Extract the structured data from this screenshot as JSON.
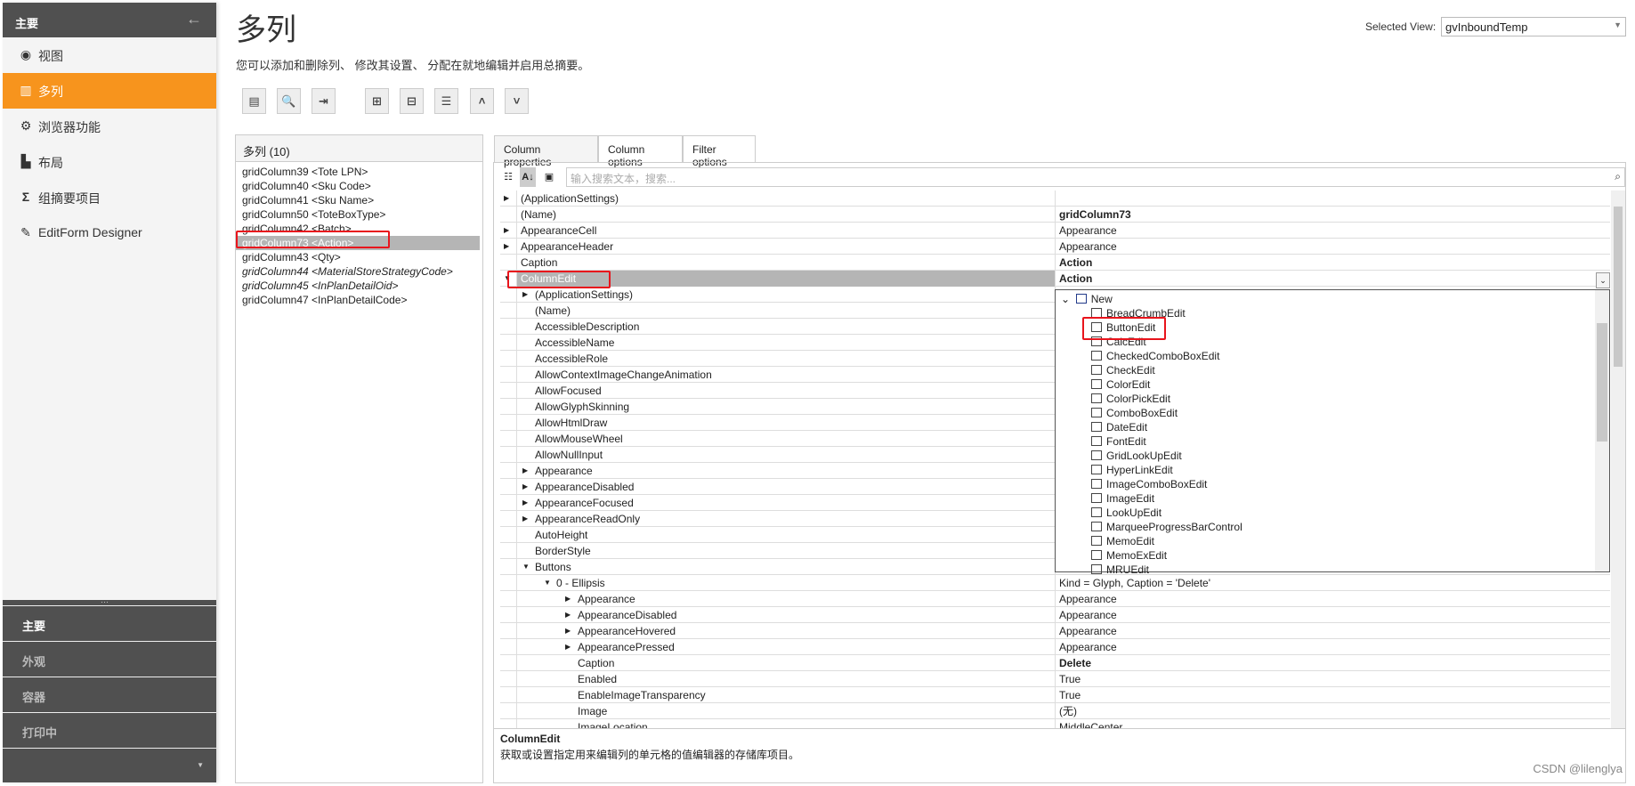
{
  "sidebar": {
    "header": "主要",
    "items": [
      {
        "icon": "eye-icon",
        "glyph": "◉",
        "label": "视图"
      },
      {
        "icon": "columns-icon",
        "glyph": "▥",
        "label": "多列",
        "active": true
      },
      {
        "icon": "gear-icon",
        "glyph": "⚙",
        "label": "浏览器功能"
      },
      {
        "icon": "layout-icon",
        "glyph": "▙",
        "label": "布局"
      },
      {
        "icon": "sigma-icon",
        "glyph": "Σ",
        "label": "组摘要项目"
      },
      {
        "icon": "edit-form-icon",
        "glyph": "✎",
        "label": "EditForm Designer"
      }
    ],
    "bottom": [
      "主要",
      "外观",
      "容器",
      "打印中"
    ]
  },
  "page": {
    "title": "多列",
    "subtitle": "您可以添加和删除列、 修改其设置、 分配在就地编辑并启用总摘要。"
  },
  "toolbar": [
    {
      "icon": "list-icon",
      "glyph": "▤"
    },
    {
      "icon": "search-icon",
      "glyph": "🔍"
    },
    {
      "icon": "export-icon",
      "glyph": "⇥"
    },
    {
      "icon": "insert-column-icon",
      "glyph": "⊞"
    },
    {
      "icon": "add-column-icon",
      "glyph": "⊟"
    },
    {
      "icon": "remove-column-icon",
      "glyph": "☰"
    },
    {
      "icon": "move-up-icon",
      "glyph": "˄"
    },
    {
      "icon": "move-down-icon",
      "glyph": "˅"
    }
  ],
  "selected_view": {
    "label": "Selected View:",
    "value": "gvInboundTemp"
  },
  "columns_panel": {
    "header": "多列 (10)",
    "items": [
      {
        "t": "gridColumn39 <Tote LPN>"
      },
      {
        "t": "gridColumn40 <Sku Code>"
      },
      {
        "t": "gridColumn41 <Sku Name>"
      },
      {
        "t": "gridColumn50 <ToteBoxType>"
      },
      {
        "t": "gridColumn42 <Batch>"
      },
      {
        "t": "gridColumn73 <Action>",
        "sel": true
      },
      {
        "t": "gridColumn43 <Qty>"
      },
      {
        "t": "gridColumn44 <MaterialStoreStrategyCode>",
        "it": true
      },
      {
        "t": "gridColumn45 <InPlanDetailOid>",
        "it": true
      },
      {
        "t": "gridColumn47 <InPlanDetailCode>"
      }
    ]
  },
  "tabs": [
    "Column properties",
    "Column options",
    "Filter options"
  ],
  "search_placeholder": "输入搜索文本，搜索...",
  "properties": [
    {
      "n": "(ApplicationSettings)",
      "v": "",
      "l": 0,
      "e": "r"
    },
    {
      "n": "(Name)",
      "v": "gridColumn73",
      "l": 0,
      "b": true
    },
    {
      "n": "AppearanceCell",
      "v": "Appearance",
      "l": 0,
      "e": "r"
    },
    {
      "n": "AppearanceHeader",
      "v": "Appearance",
      "l": 0,
      "e": "r"
    },
    {
      "n": "Caption",
      "v": "Action",
      "l": 0,
      "b": true
    },
    {
      "n": "ColumnEdit",
      "v": "Action",
      "l": 0,
      "e": "d",
      "b": true,
      "sel": true
    },
    {
      "n": "(ApplicationSettings)",
      "v": "",
      "l": 1,
      "e": "r"
    },
    {
      "n": "(Name)",
      "v": "",
      "l": 1
    },
    {
      "n": "AccessibleDescription",
      "v": "",
      "l": 1
    },
    {
      "n": "AccessibleName",
      "v": "",
      "l": 1
    },
    {
      "n": "AccessibleRole",
      "v": "",
      "l": 1
    },
    {
      "n": "AllowContextImageChangeAnimation",
      "v": "",
      "l": 1
    },
    {
      "n": "AllowFocused",
      "v": "",
      "l": 1
    },
    {
      "n": "AllowGlyphSkinning",
      "v": "",
      "l": 1
    },
    {
      "n": "AllowHtmlDraw",
      "v": "",
      "l": 1
    },
    {
      "n": "AllowMouseWheel",
      "v": "",
      "l": 1
    },
    {
      "n": "AllowNullInput",
      "v": "",
      "l": 1
    },
    {
      "n": "Appearance",
      "v": "",
      "l": 1,
      "e": "r"
    },
    {
      "n": "AppearanceDisabled",
      "v": "",
      "l": 1,
      "e": "r"
    },
    {
      "n": "AppearanceFocused",
      "v": "",
      "l": 1,
      "e": "r"
    },
    {
      "n": "AppearanceReadOnly",
      "v": "",
      "l": 1,
      "e": "r"
    },
    {
      "n": "AutoHeight",
      "v": "",
      "l": 1
    },
    {
      "n": "BorderStyle",
      "v": "",
      "l": 1
    },
    {
      "n": "Buttons",
      "v": "",
      "l": 1,
      "e": "d"
    },
    {
      "n": "0 - Ellipsis",
      "v": "Kind = Glyph, Caption = 'Delete'",
      "l": 2,
      "e": "d"
    },
    {
      "n": "Appearance",
      "v": "Appearance",
      "l": 3,
      "e": "r"
    },
    {
      "n": "AppearanceDisabled",
      "v": "Appearance",
      "l": 3,
      "e": "r"
    },
    {
      "n": "AppearanceHovered",
      "v": "Appearance",
      "l": 3,
      "e": "r"
    },
    {
      "n": "AppearancePressed",
      "v": "Appearance",
      "l": 3,
      "e": "r"
    },
    {
      "n": "Caption",
      "v": "Delete",
      "l": 3,
      "b": true
    },
    {
      "n": "Enabled",
      "v": "True",
      "l": 3
    },
    {
      "n": "EnableImageTransparency",
      "v": "True",
      "l": 3
    },
    {
      "n": "Image",
      "v": "(无)",
      "l": 3
    },
    {
      "n": "ImageLocation",
      "v": "MiddleCenter",
      "l": 3
    }
  ],
  "editor_dropdown": {
    "root": "New",
    "items": [
      "BreadCrumbEdit",
      "ButtonEdit",
      "CalcEdit",
      "CheckedComboBoxEdit",
      "CheckEdit",
      "ColorEdit",
      "ColorPickEdit",
      "ComboBoxEdit",
      "DateEdit",
      "FontEdit",
      "GridLookUpEdit",
      "HyperLinkEdit",
      "ImageComboBoxEdit",
      "ImageEdit",
      "LookUpEdit",
      "MarqueeProgressBarControl",
      "MemoEdit",
      "MemoExEdit",
      "MRUEdit"
    ]
  },
  "description": {
    "title": "ColumnEdit",
    "text": "获取或设置指定用来编辑列的单元格的值编辑器的存储库项目。"
  },
  "watermark": "CSDN @lilenglya",
  "colors": {
    "accent": "#f7941d",
    "sidebar_dark": "#505050",
    "selection": "#b5b5b5",
    "highlight": "#e8141c"
  }
}
